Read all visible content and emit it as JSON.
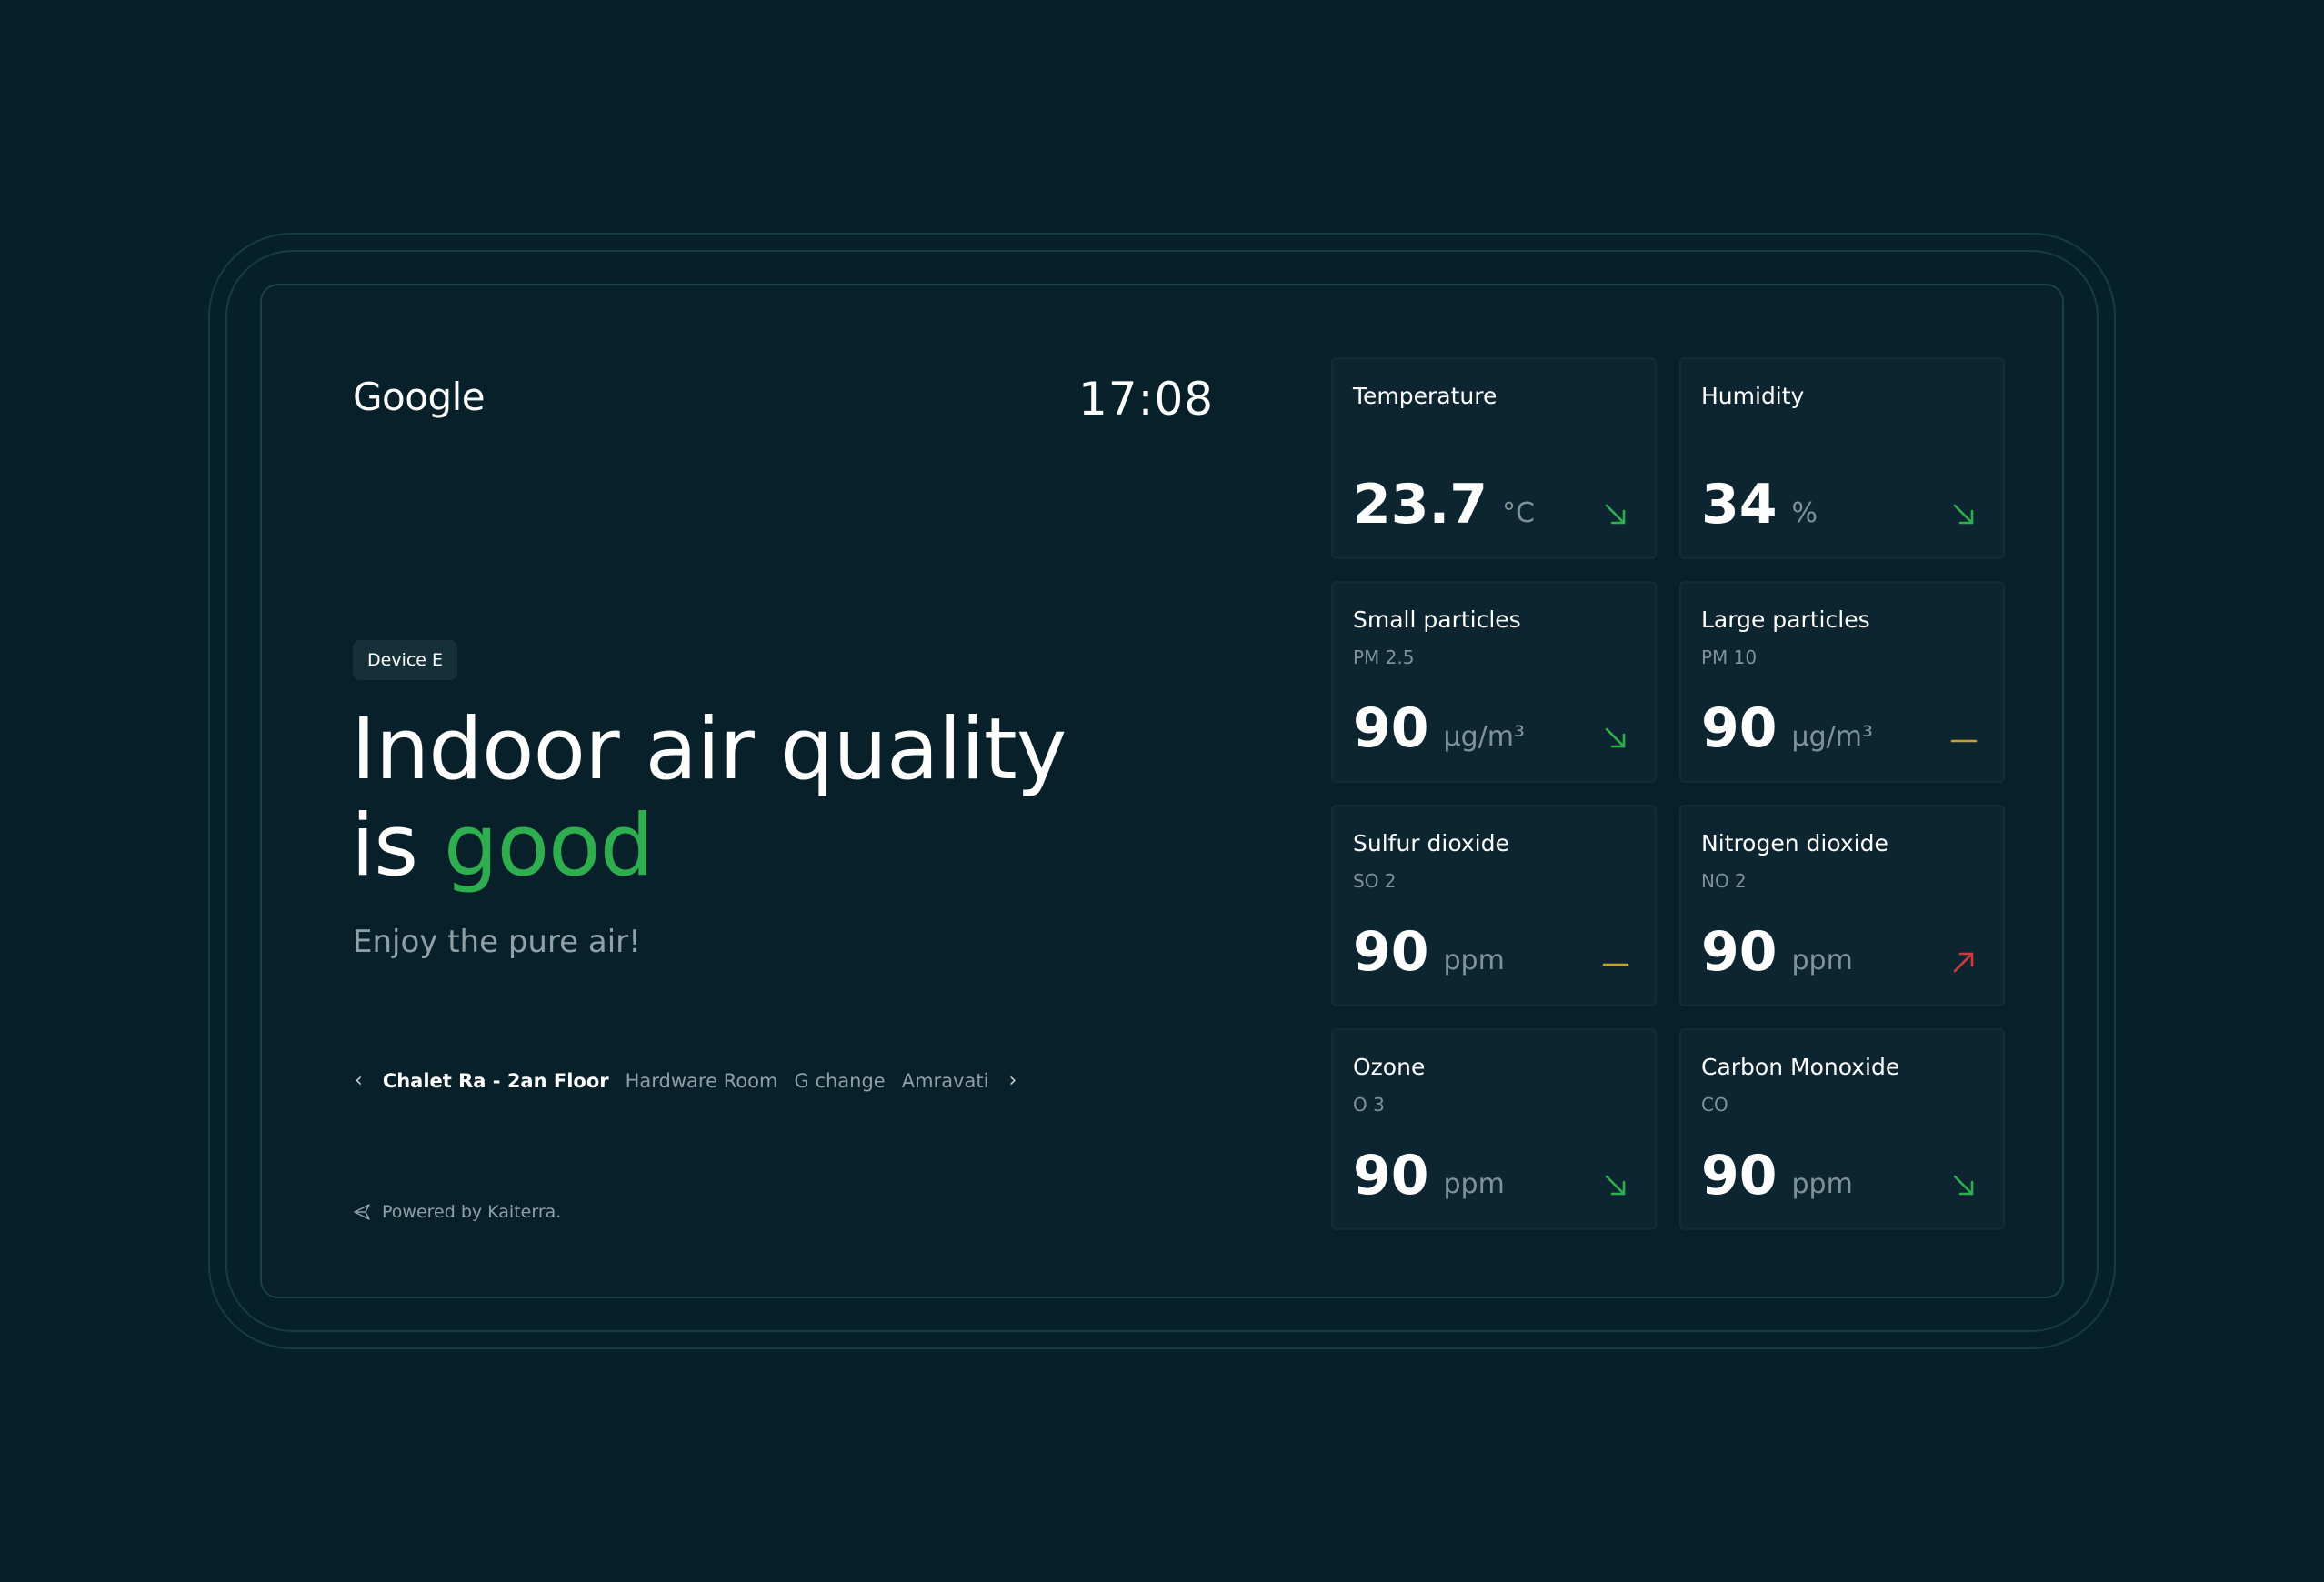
{
  "brand": {
    "name": "Google"
  },
  "clock": {
    "time": "17:08"
  },
  "device": {
    "label": "Device E"
  },
  "status": {
    "headline_line1": "Indoor air quality",
    "headline_is": "is",
    "headline_rating": "good",
    "subline": "Enjoy the pure air!",
    "rating_color": "#2fae4f"
  },
  "locations": {
    "prev_icon": "chevron-left-icon",
    "next_icon": "chevron-right-icon",
    "items": [
      {
        "label": "Chalet Ra - 2an Floor",
        "active": true
      },
      {
        "label": "Hardware Room",
        "active": false
      },
      {
        "label": "G change",
        "active": false
      },
      {
        "label": "Amravati",
        "active": false
      }
    ]
  },
  "footer": {
    "powered_by": "Powered by Kaiterra.",
    "icon": "kaiterra-logo-icon"
  },
  "metrics": [
    {
      "title": "Temperature",
      "subtitle": "",
      "value": "23.7",
      "unit": "°C",
      "trend": "down",
      "trend_color": "#2fae4f"
    },
    {
      "title": "Humidity",
      "subtitle": "",
      "value": "34",
      "unit": "%",
      "trend": "down",
      "trend_color": "#2fae4f"
    },
    {
      "title": "Small particles",
      "subtitle": "PM 2.5",
      "value": "90",
      "unit": "µg/m³",
      "trend": "down",
      "trend_color": "#2fae4f"
    },
    {
      "title": "Large particles",
      "subtitle": "PM 10",
      "value": "90",
      "unit": "µg/m³",
      "trend": "flat",
      "trend_color": "#c9a227"
    },
    {
      "title": "Sulfur dioxide",
      "subtitle": "SO 2",
      "value": "90",
      "unit": "ppm",
      "trend": "flat",
      "trend_color": "#c9a227"
    },
    {
      "title": "Nitrogen dioxide",
      "subtitle": "NO 2",
      "value": "90",
      "unit": "ppm",
      "trend": "up",
      "trend_color": "#d03a3a"
    },
    {
      "title": "Ozone",
      "subtitle": "O 3",
      "value": "90",
      "unit": "ppm",
      "trend": "down",
      "trend_color": "#2fae4f"
    },
    {
      "title": "Carbon Monoxide",
      "subtitle": "CO",
      "value": "90",
      "unit": "ppm",
      "trend": "down",
      "trend_color": "#2fae4f"
    }
  ]
}
